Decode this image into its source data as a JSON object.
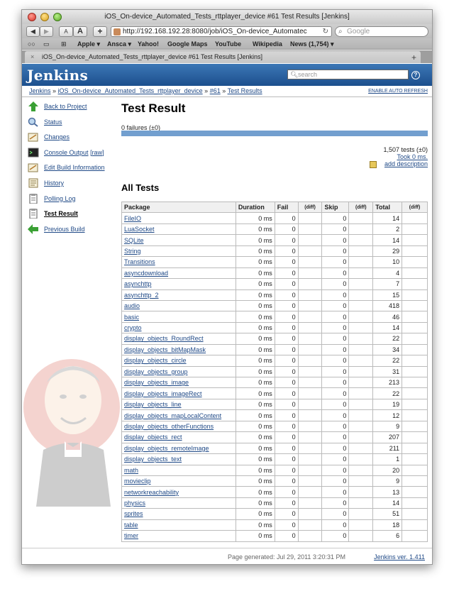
{
  "browser": {
    "window_title": "iOS_On-device_Automated_Tests_rttplayer_device #61 Test Results [Jenkins]",
    "url": "http://192.168.192.28:8080/job/iOS_On-device_Automatec",
    "search_placeholder": "Google",
    "tab_title": "iOS_On-device_Automated_Tests_rttplayer_device #61 Test Results [Jenkins]",
    "bookmarks": [
      "Apple ▾",
      "Ansca ▾",
      "Yahoo!",
      "Google Maps",
      "YouTube",
      "Wikipedia",
      "News (1,754) ▾"
    ]
  },
  "jenkins": {
    "logo": "Jenkins",
    "search_placeholder": "search",
    "help_label": "?",
    "enable_auto_refresh": "ENABLE AUTO REFRESH",
    "breadcrumbs": [
      "Jenkins",
      "iOS_On-device_Automated_Tests_rttplayer_device",
      "#61",
      "Test Results"
    ]
  },
  "sidebar": {
    "items": [
      {
        "label": "Back to Project",
        "icon": "up-arrow-icon"
      },
      {
        "label": "Status",
        "icon": "magnifier-icon"
      },
      {
        "label": "Changes",
        "icon": "notepad-icon"
      },
      {
        "label": "Console Output",
        "extra": "[raw]",
        "icon": "terminal-icon"
      },
      {
        "label": "Edit Build Information",
        "icon": "notepad-icon"
      },
      {
        "label": "History",
        "icon": "notepad-icon"
      },
      {
        "label": "Polling Log",
        "icon": "clipboard-icon"
      },
      {
        "label": "Test Result",
        "icon": "clipboard-icon",
        "active": true
      },
      {
        "label": "Previous Build",
        "icon": "left-arrow-icon"
      }
    ]
  },
  "main": {
    "title": "Test Result",
    "failures": "0 failures (±0)",
    "tests_count": "1,507 tests (±0)",
    "took": "Took 0 ms.",
    "add_description": "add description",
    "all_tests_title": "All Tests",
    "table": {
      "headers": {
        "package": "Package",
        "duration": "Duration",
        "fail": "Fail",
        "fail_diff": "(diff)",
        "skip": "Skip",
        "skip_diff": "(diff)",
        "total": "Total",
        "total_diff": "(diff)"
      },
      "rows": [
        {
          "package": "FileIO",
          "duration": "0 ms",
          "fail": "0",
          "skip": "0",
          "total": "14"
        },
        {
          "package": "LuaSocket",
          "duration": "0 ms",
          "fail": "0",
          "skip": "0",
          "total": "2"
        },
        {
          "package": "SQLite",
          "duration": "0 ms",
          "fail": "0",
          "skip": "0",
          "total": "14"
        },
        {
          "package": "String",
          "duration": "0 ms",
          "fail": "0",
          "skip": "0",
          "total": "29"
        },
        {
          "package": "Transitions",
          "duration": "0 ms",
          "fail": "0",
          "skip": "0",
          "total": "10"
        },
        {
          "package": "asyncdownload",
          "duration": "0 ms",
          "fail": "0",
          "skip": "0",
          "total": "4"
        },
        {
          "package": "asynchttp",
          "duration": "0 ms",
          "fail": "0",
          "skip": "0",
          "total": "7"
        },
        {
          "package": "asynchttp_2",
          "duration": "0 ms",
          "fail": "0",
          "skip": "0",
          "total": "15"
        },
        {
          "package": "audio",
          "duration": "0 ms",
          "fail": "0",
          "skip": "0",
          "total": "418"
        },
        {
          "package": "basic",
          "duration": "0 ms",
          "fail": "0",
          "skip": "0",
          "total": "46"
        },
        {
          "package": "crypto",
          "duration": "0 ms",
          "fail": "0",
          "skip": "0",
          "total": "14"
        },
        {
          "package": "display_objects_RoundRect",
          "duration": "0 ms",
          "fail": "0",
          "skip": "0",
          "total": "22"
        },
        {
          "package": "display_objects_bitMapMask",
          "duration": "0 ms",
          "fail": "0",
          "skip": "0",
          "total": "34"
        },
        {
          "package": "display_objects_circle",
          "duration": "0 ms",
          "fail": "0",
          "skip": "0",
          "total": "22"
        },
        {
          "package": "display_objects_group",
          "duration": "0 ms",
          "fail": "0",
          "skip": "0",
          "total": "31"
        },
        {
          "package": "display_objects_image",
          "duration": "0 ms",
          "fail": "0",
          "skip": "0",
          "total": "213"
        },
        {
          "package": "display_objects_imageRect",
          "duration": "0 ms",
          "fail": "0",
          "skip": "0",
          "total": "22"
        },
        {
          "package": "display_objects_line",
          "duration": "0 ms",
          "fail": "0",
          "skip": "0",
          "total": "19"
        },
        {
          "package": "display_objects_mapLocalContent",
          "duration": "0 ms",
          "fail": "0",
          "skip": "0",
          "total": "12"
        },
        {
          "package": "display_objects_otherFunctions",
          "duration": "0 ms",
          "fail": "0",
          "skip": "0",
          "total": "9"
        },
        {
          "package": "display_objects_rect",
          "duration": "0 ms",
          "fail": "0",
          "skip": "0",
          "total": "207"
        },
        {
          "package": "display_objects_remoteImage",
          "duration": "0 ms",
          "fail": "0",
          "skip": "0",
          "total": "211"
        },
        {
          "package": "display_objects_text",
          "duration": "0 ms",
          "fail": "0",
          "skip": "0",
          "total": "1"
        },
        {
          "package": "math",
          "duration": "0 ms",
          "fail": "0",
          "skip": "0",
          "total": "20"
        },
        {
          "package": "movieclip",
          "duration": "0 ms",
          "fail": "0",
          "skip": "0",
          "total": "9"
        },
        {
          "package": "networkreachability",
          "duration": "0 ms",
          "fail": "0",
          "skip": "0",
          "total": "13"
        },
        {
          "package": "physics",
          "duration": "0 ms",
          "fail": "0",
          "skip": "0",
          "total": "14"
        },
        {
          "package": "sprites",
          "duration": "0 ms",
          "fail": "0",
          "skip": "0",
          "total": "51"
        },
        {
          "package": "table",
          "duration": "0 ms",
          "fail": "0",
          "skip": "0",
          "total": "18"
        },
        {
          "package": "timer",
          "duration": "0 ms",
          "fail": "0",
          "skip": "0",
          "total": "6"
        }
      ]
    }
  },
  "footer": {
    "generated": "Page generated: Jul 29, 2011 3:20:31 PM",
    "version": "Jenkins ver. 1.411"
  },
  "colors": {
    "header_blue": "#1c4f8d",
    "link_blue": "#204a87",
    "progress_blue": "#729fcf"
  },
  "progress": {
    "pass_fraction": 1.0
  }
}
